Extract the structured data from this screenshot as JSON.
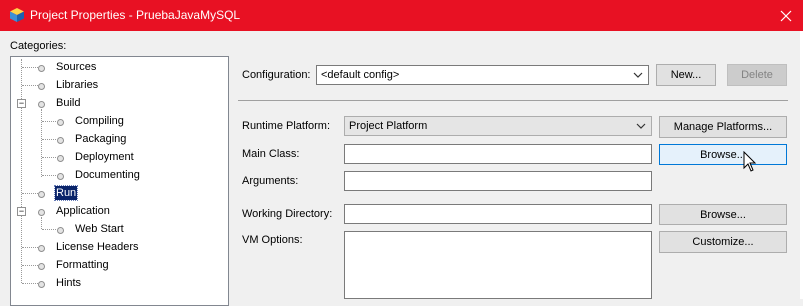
{
  "window": {
    "title": "Project Properties - PruebaJavaMySQL",
    "app_icon": "netbeans-cube-icon",
    "close_icon": "close-icon",
    "accent_color": "#e81123"
  },
  "categories": {
    "label": "Categories:",
    "items": [
      {
        "label": "Sources"
      },
      {
        "label": "Libraries"
      },
      {
        "label": "Build",
        "expanded": true
      },
      {
        "label": "Compiling"
      },
      {
        "label": "Packaging"
      },
      {
        "label": "Deployment"
      },
      {
        "label": "Documenting"
      },
      {
        "label": "Run",
        "selected": true
      },
      {
        "label": "Application",
        "expanded": true
      },
      {
        "label": "Web Start"
      },
      {
        "label": "License Headers"
      },
      {
        "label": "Formatting"
      },
      {
        "label": "Hints"
      }
    ]
  },
  "configuration": {
    "label": "Configuration:",
    "value": "<default config>",
    "new_button": "New...",
    "delete_button": "Delete"
  },
  "runtime_platform": {
    "label": "Runtime Platform:",
    "value": "Project Platform",
    "manage_button": "Manage Platforms..."
  },
  "main_class": {
    "label": "Main Class:",
    "value": "",
    "browse_button": "Browse..."
  },
  "arguments": {
    "label": "Arguments:",
    "value": ""
  },
  "working_directory": {
    "label": "Working Directory:",
    "value": "",
    "browse_button": "Browse..."
  },
  "vm_options": {
    "label": "VM Options:",
    "value": "",
    "customize_button": "Customize..."
  }
}
